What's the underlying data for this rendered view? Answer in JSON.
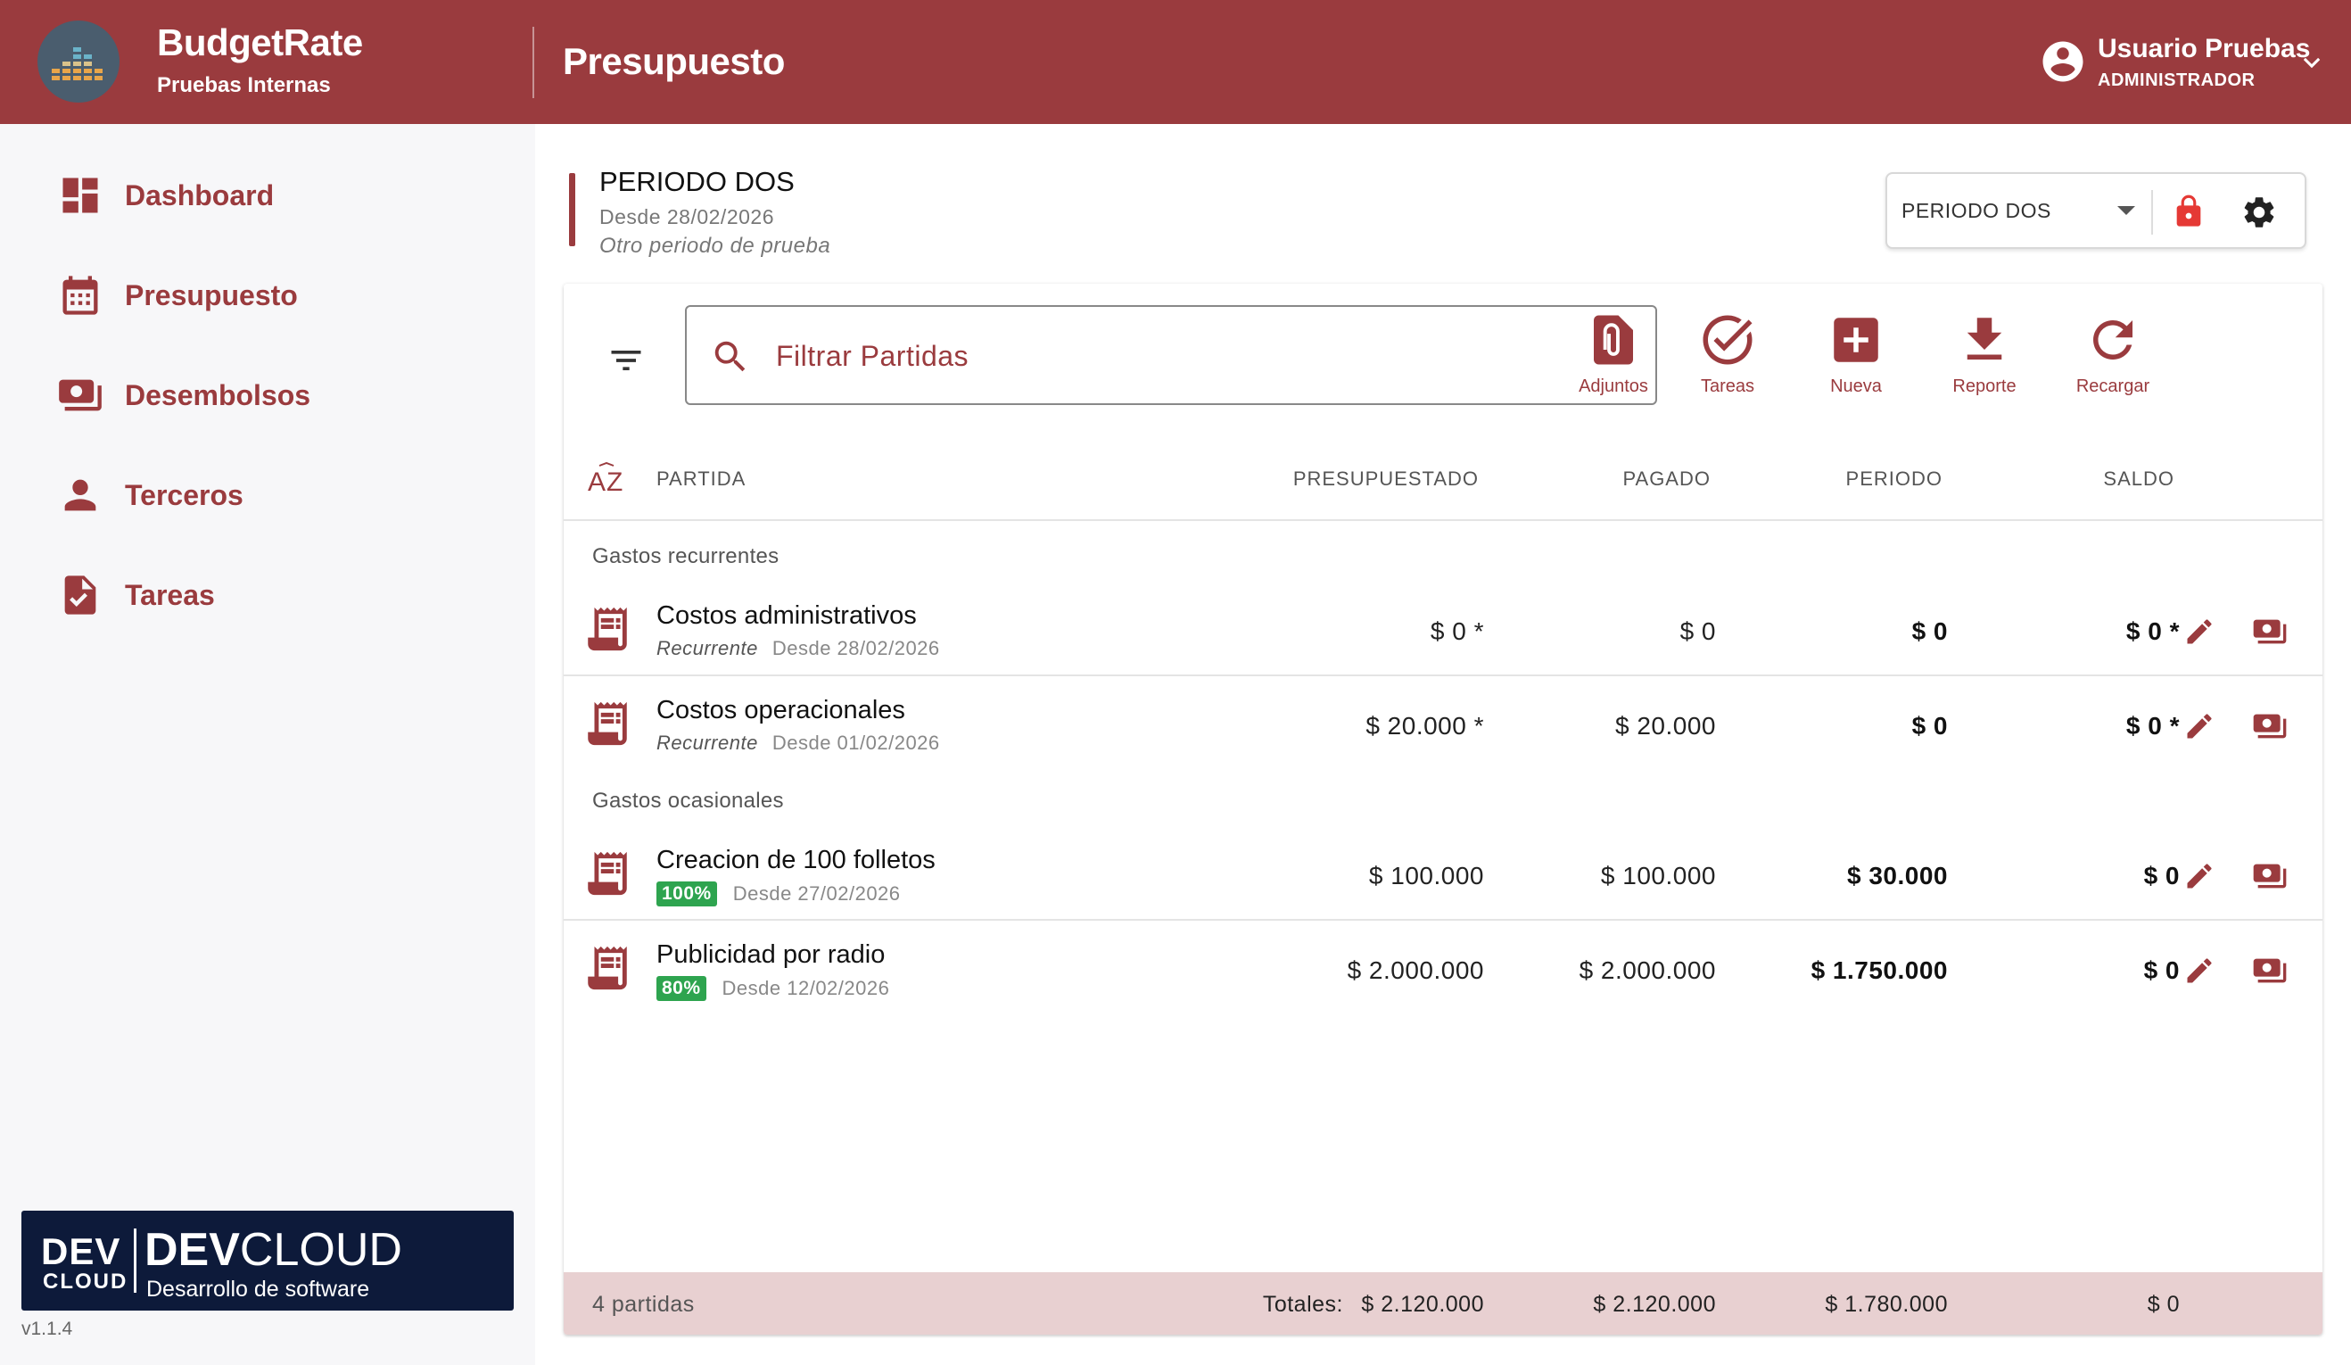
{
  "header": {
    "app_name": "BudgetRate",
    "app_subtitle": "Pruebas Internas",
    "page_title": "Presupuesto",
    "user_name": "Usuario Pruebas",
    "user_role": "ADMINISTRADOR"
  },
  "sidebar": {
    "items": [
      {
        "label": "Dashboard",
        "icon": "dashboard-icon"
      },
      {
        "label": "Presupuesto",
        "icon": "calendar-icon"
      },
      {
        "label": "Desembolsos",
        "icon": "payments-icon"
      },
      {
        "label": "Terceros",
        "icon": "person-icon"
      },
      {
        "label": "Tareas",
        "icon": "task-icon"
      }
    ],
    "brand": {
      "dev": "DEV",
      "cloud": "CLOUD",
      "title_bold": "DEV",
      "title_rest": "CLOUD",
      "subtitle": "Desarrollo de software"
    },
    "version": "v1.1.4"
  },
  "period": {
    "title": "PERIODO DOS",
    "since": "Desde 28/02/2026",
    "description": "Otro periodo de prueba",
    "selected": "PERIODO DOS"
  },
  "search": {
    "placeholder": "Filtrar Partidas",
    "value": ""
  },
  "toolbar": {
    "attachments": "Adjuntos",
    "tasks": "Tareas",
    "new": "Nueva",
    "report": "Reporte",
    "reload": "Recargar"
  },
  "table": {
    "columns": {
      "partida": "PARTIDA",
      "budgeted": "PRESUPUESTADO",
      "paid": "PAGADO",
      "period": "PERIODO",
      "balance": "SALDO"
    },
    "groups": [
      {
        "label": "Gastos recurrentes",
        "rows": [
          {
            "name": "Costos administrativos",
            "type": "Recurrente",
            "since": "Desde 28/02/2026",
            "budgeted": "$ 0 *",
            "paid": "$ 0",
            "period": "$ 0",
            "balance": "$ 0 *"
          },
          {
            "name": "Costos operacionales",
            "type": "Recurrente",
            "since": "Desde 01/02/2026",
            "budgeted": "$ 20.000 *",
            "paid": "$ 20.000",
            "period": "$ 0",
            "balance": "$ 0 *"
          }
        ]
      },
      {
        "label": "Gastos ocasionales",
        "rows": [
          {
            "name": "Creacion de 100 folletos",
            "progress": "100%",
            "since": "Desde 27/02/2026",
            "budgeted": "$ 100.000",
            "paid": "$ 100.000",
            "period": "$ 30.000",
            "balance": "$ 0"
          },
          {
            "name": "Publicidad por radio",
            "progress": "80%",
            "since": "Desde 12/02/2026",
            "budgeted": "$ 2.000.000",
            "paid": "$ 2.000.000",
            "period": "$ 1.750.000",
            "balance": "$ 0"
          }
        ]
      }
    ],
    "footer": {
      "count": "4 partidas",
      "totals_label": "Totales:",
      "budgeted": "$ 2.120.000",
      "paid": "$ 2.120.000",
      "period": "$ 1.780.000",
      "balance": "$ 0"
    }
  },
  "colors": {
    "primary": "#9a3b3e",
    "success": "#2ea44f",
    "footer": "#e8d0d1",
    "lock": "#e53935"
  }
}
